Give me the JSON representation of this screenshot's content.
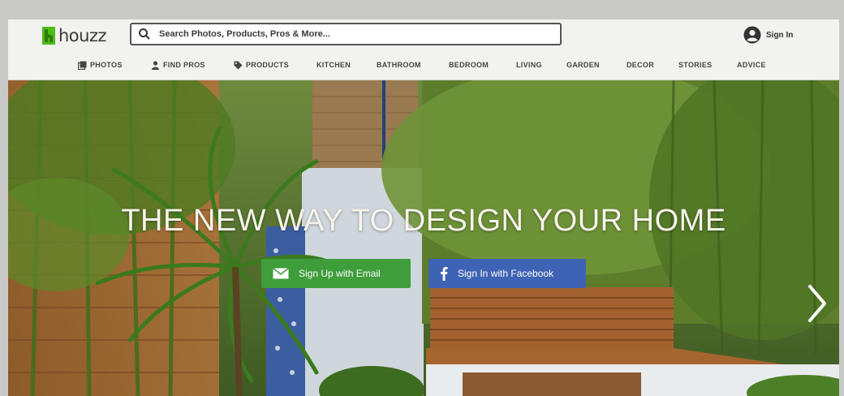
{
  "colors": {
    "brand_green": "#4dbc15",
    "email_button": "#3f9d3b",
    "facebook_button": "#3f63b4",
    "hero_text": "#f7f4ec"
  },
  "header": {
    "logo_text": "houzz",
    "search": {
      "placeholder": "Search Photos, Products, Pros & More...",
      "value": ""
    },
    "sign_in": {
      "label": "Sign In",
      "icon": "user-circle-icon"
    }
  },
  "nav": {
    "items": [
      {
        "label": "PHOTOS",
        "icon": "photos-icon"
      },
      {
        "label": "FIND PROS",
        "icon": "person-icon"
      },
      {
        "label": "PRODUCTS",
        "icon": "tag-icon"
      },
      {
        "label": "KITCHEN"
      },
      {
        "label": "BATHROOM"
      },
      {
        "label": "BEDROOM"
      },
      {
        "label": "LIVING"
      },
      {
        "label": "GARDEN"
      },
      {
        "label": "DECOR"
      },
      {
        "label": "STORIES"
      },
      {
        "label": "ADVICE"
      }
    ]
  },
  "hero": {
    "title": "THE NEW WAY TO DESIGN YOUR HOME",
    "email_button": {
      "label": "Sign Up with Email",
      "icon": "envelope-icon"
    },
    "facebook_button": {
      "label": "Sign In with Facebook",
      "icon": "facebook-icon"
    },
    "next_icon": "chevron-right-icon"
  }
}
